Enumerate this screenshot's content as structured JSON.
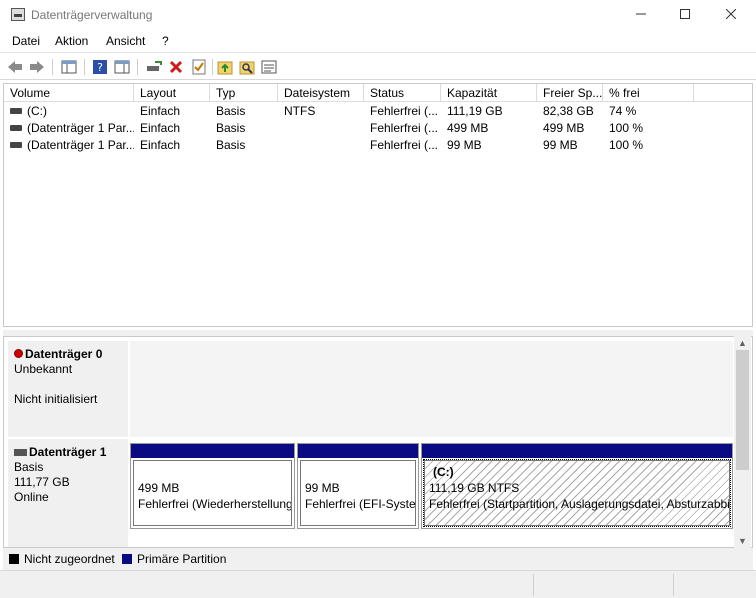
{
  "window": {
    "title": "Datenträgerverwaltung"
  },
  "menu": {
    "items": [
      "Datei",
      "Aktion",
      "Ansicht",
      "?"
    ]
  },
  "table": {
    "columns": [
      "Volume",
      "Layout",
      "Typ",
      "Dateisystem",
      "Status",
      "Kapazität",
      "Freier Sp...",
      "% frei"
    ],
    "rows": [
      [
        "(C:)",
        "Einfach",
        "Basis",
        "NTFS",
        "Fehlerfrei (...",
        "111,19 GB",
        "82,38 GB",
        "74 %"
      ],
      [
        "(Datenträger 1 Par...",
        "Einfach",
        "Basis",
        "",
        "Fehlerfrei (...",
        "499 MB",
        "499 MB",
        "100 %"
      ],
      [
        "(Datenträger 1 Par...",
        "Einfach",
        "Basis",
        "",
        "Fehlerfrei (...",
        "99 MB",
        "99 MB",
        "100 %"
      ]
    ]
  },
  "disks": [
    {
      "name": "Datenträger 0",
      "line1": "Unbekannt",
      "line2": "",
      "line3": "Nicht initialisiert"
    },
    {
      "name": "Datenträger 1",
      "line1": "Basis",
      "line2": "111,77 GB",
      "line3": "Online"
    }
  ],
  "partitions": [
    {
      "title": "",
      "size": "499 MB",
      "status": "Fehlerfrei (Wiederherstellung"
    },
    {
      "title": "",
      "size": "99 MB",
      "status": "Fehlerfrei (EFI-Syster"
    },
    {
      "title": "(C:)",
      "size": "111,19 GB NTFS",
      "status": "Fehlerfrei (Startpartition, Auslagerungsdatei, Absturzabbi"
    }
  ],
  "legend": [
    {
      "label": "Nicht zugeordnet",
      "color": "#000000"
    },
    {
      "label": "Primäre Partition",
      "color": "#0a0a82"
    }
  ],
  "colors": {
    "partition_bar": "#0a0a82",
    "delete_icon": "#d11a1a"
  }
}
